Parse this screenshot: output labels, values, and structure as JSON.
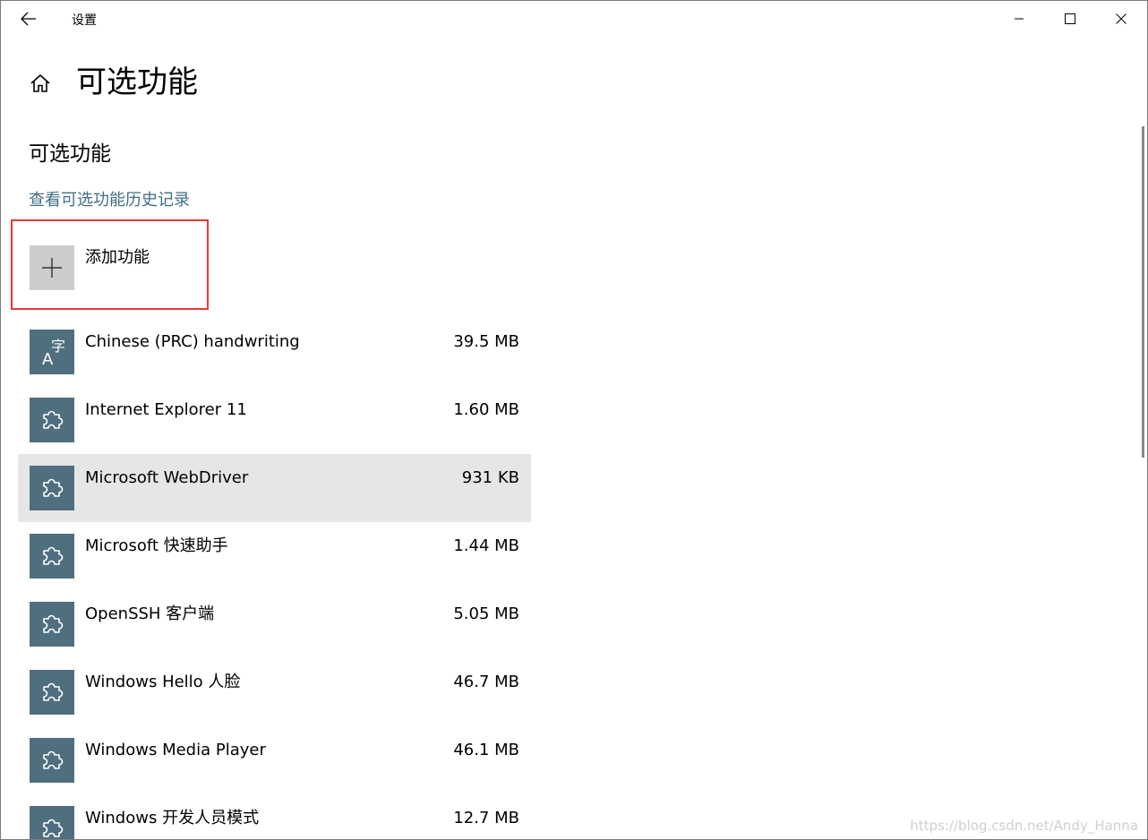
{
  "window": {
    "title": "设置"
  },
  "page": {
    "title": "可选功能",
    "section_title": "可选功能",
    "history_link": "查看可选功能历史记录",
    "add_feature_label": "添加功能"
  },
  "features": [
    {
      "name": "Chinese (PRC) handwriting",
      "size": "39.5 MB",
      "icon": "language-icon",
      "selected": false
    },
    {
      "name": "Internet Explorer 11",
      "size": "1.60 MB",
      "icon": "puzzle-icon",
      "selected": false
    },
    {
      "name": "Microsoft WebDriver",
      "size": "931 KB",
      "icon": "puzzle-icon",
      "selected": true
    },
    {
      "name": "Microsoft 快速助手",
      "size": "1.44 MB",
      "icon": "puzzle-icon",
      "selected": false
    },
    {
      "name": "OpenSSH 客户端",
      "size": "5.05 MB",
      "icon": "puzzle-icon",
      "selected": false
    },
    {
      "name": "Windows Hello 人脸",
      "size": "46.7 MB",
      "icon": "puzzle-icon",
      "selected": false
    },
    {
      "name": "Windows Media Player",
      "size": "46.1 MB",
      "icon": "puzzle-icon",
      "selected": false
    },
    {
      "name": "Windows 开发人员模式",
      "size": "12.7 MB",
      "icon": "puzzle-icon",
      "selected": false
    }
  ],
  "watermark": "https://blog.csdn.net/Andy_Hanna",
  "colors": {
    "accent_link": "#3f6f84",
    "tile": "#4f6f7f",
    "highlight_border": "#e53a3a",
    "selected_row": "#e6e6e6"
  }
}
